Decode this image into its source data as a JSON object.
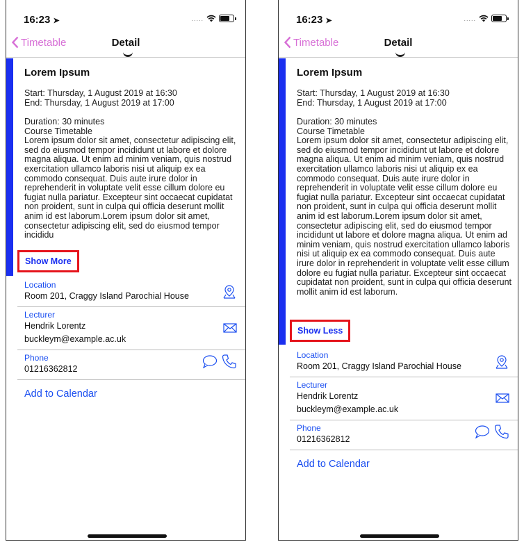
{
  "status": {
    "time": "16:23"
  },
  "nav": {
    "back_label": "Timetable",
    "title": "Detail"
  },
  "event": {
    "title": "Lorem Ipsum",
    "start": "Start: Thursday, 1 August 2019 at 16:30",
    "end": "End: Thursday, 1 August 2019 at 17:00",
    "duration": "Duration: 30 minutes",
    "course": "Course Timetable",
    "description_short": "Lorem ipsum dolor sit amet, consectetur adipiscing elit, sed do eiusmod tempor incididunt ut labore et dolore magna aliqua. Ut enim ad minim veniam, quis nostrud exercitation ullamco laboris nisi ut aliquip ex ea commodo consequat. Duis aute irure dolor in reprehenderit in voluptate velit esse cillum dolore eu fugiat nulla pariatur. Excepteur sint occaecat cupidatat non proident, sunt in culpa qui officia deserunt mollit anim id est laborum.Lorem ipsum dolor sit amet, consectetur adipiscing elit, sed do eiusmod tempor incididu",
    "description_full": "Lorem ipsum dolor sit amet, consectetur adipiscing elit, sed do eiusmod tempor incididunt ut labore et dolore magna aliqua. Ut enim ad minim veniam, quis nostrud exercitation ullamco laboris nisi ut aliquip ex ea commodo consequat. Duis aute irure dolor in reprehenderit in voluptate velit esse cillum dolore eu fugiat nulla pariatur. Excepteur sint occaecat cupidatat non proident, sunt in culpa qui officia deserunt mollit anim id est laborum.Lorem ipsum dolor sit amet, consectetur adipiscing elit, sed do eiusmod tempor incididunt ut labore et dolore magna aliqua. Ut enim ad minim veniam, quis nostrud exercitation ullamco laboris nisi ut aliquip ex ea commodo consequat. Duis aute irure dolor in reprehenderit in voluptate velit esse cillum dolore eu fugiat nulla pariatur. Excepteur sint occaecat cupidatat non proident, sunt in culpa qui officia deserunt mollit anim id est laborum."
  },
  "buttons": {
    "show_more": "Show More",
    "show_less": "Show Less",
    "add_calendar": "Add to Calendar"
  },
  "location": {
    "label": "Location",
    "value": "Room 201, Craggy Island Parochial House"
  },
  "lecturer": {
    "label": "Lecturer",
    "name": "Hendrik Lorentz",
    "email": "buckleym@example.ac.uk"
  },
  "phone": {
    "label": "Phone",
    "value": "01216362812"
  },
  "colors": {
    "accent": "#1a2ff0",
    "link": "#1a4ef0",
    "back": "#d76fd6",
    "highlight": "#e5141c"
  },
  "icons": [
    "location-pin-icon",
    "mail-icon",
    "chat-bubble-icon",
    "phone-icon",
    "chevron-left-icon",
    "wifi-icon",
    "battery-icon"
  ]
}
